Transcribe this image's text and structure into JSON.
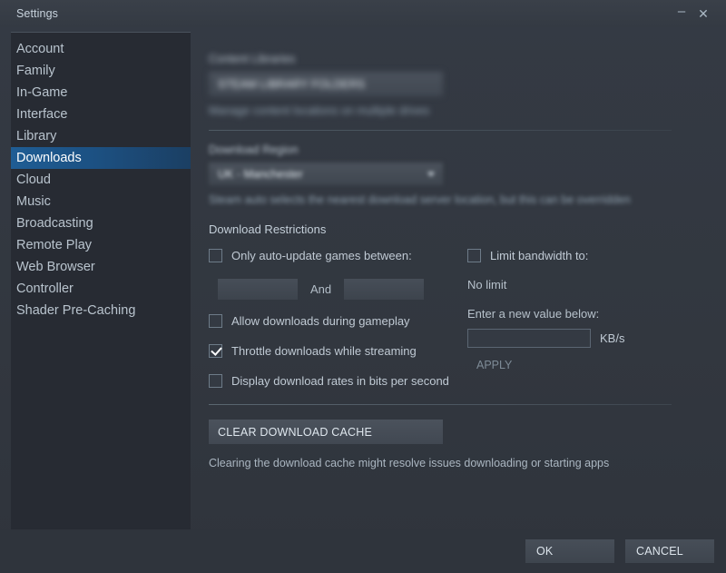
{
  "window": {
    "title": "Settings",
    "minimize_icon": "minimize-icon",
    "minimize_glyph": "–",
    "close_icon": "close-icon",
    "close_glyph": "✕"
  },
  "sidebar": {
    "items": [
      {
        "label": "Account",
        "selected": false
      },
      {
        "label": "Family",
        "selected": false
      },
      {
        "label": "In-Game",
        "selected": false
      },
      {
        "label": "Interface",
        "selected": false
      },
      {
        "label": "Library",
        "selected": false
      },
      {
        "label": "Downloads",
        "selected": true
      },
      {
        "label": "Cloud",
        "selected": false
      },
      {
        "label": "Music",
        "selected": false
      },
      {
        "label": "Broadcasting",
        "selected": false
      },
      {
        "label": "Remote Play",
        "selected": false
      },
      {
        "label": "Web Browser",
        "selected": false
      },
      {
        "label": "Controller",
        "selected": false
      },
      {
        "label": "Shader Pre-Caching",
        "selected": false
      }
    ]
  },
  "content": {
    "content_libraries": {
      "label": "Content Libraries",
      "path_button": "STEAM LIBRARY FOLDERS",
      "hint": "Manage content locations on multiple drives"
    },
    "download_region": {
      "label": "Download Region",
      "selected": "UK - Manchester",
      "hint": "Steam auto selects the nearest download server location, but this can be overridden"
    },
    "download_restrictions": {
      "title": "Download Restrictions",
      "auto_update": {
        "label": "Only auto-update games between:",
        "checked": false,
        "start_value": "",
        "and_label": "And",
        "end_value": ""
      },
      "checkboxes": [
        {
          "label": "Allow downloads during gameplay",
          "checked": false
        },
        {
          "label": "Throttle downloads while streaming",
          "checked": true
        },
        {
          "label": "Display download rates in bits per second",
          "checked": false
        }
      ],
      "bandwidth": {
        "limit_label": "Limit bandwidth to:",
        "limit_checked": false,
        "current_status": "No limit",
        "enter_label": "Enter a new value below:",
        "value": "",
        "unit": "KB/s",
        "apply_label": "APPLY"
      }
    },
    "cache": {
      "button_label": "CLEAR DOWNLOAD CACHE",
      "hint": "Clearing the download cache might resolve issues downloading or starting apps"
    }
  },
  "footer": {
    "ok_label": "OK",
    "cancel_label": "CANCEL"
  },
  "colors": {
    "accent_selected": "#1f5d94",
    "window_bg": "#343a43",
    "sidebar_bg": "#272b33",
    "text_primary": "#c6d4df"
  }
}
